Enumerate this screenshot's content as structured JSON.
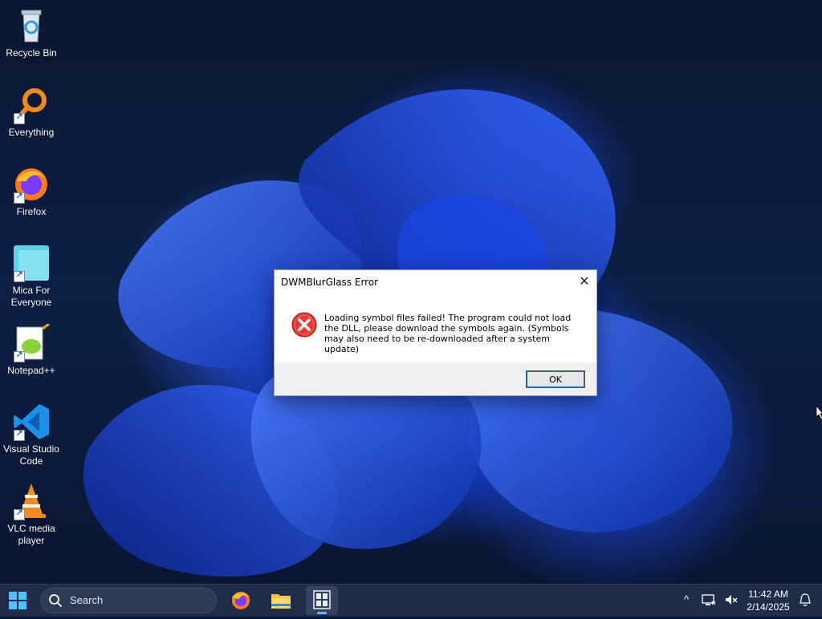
{
  "desktop": {
    "icons": [
      {
        "label": "Recycle Bin",
        "icon": "recycle-bin-icon"
      },
      {
        "label": "Everything",
        "icon": "everything-search-icon"
      },
      {
        "label": "Firefox",
        "icon": "firefox-icon"
      },
      {
        "label": "Mica For Everyone",
        "icon": "mica-icon"
      },
      {
        "label": "Notepad++",
        "icon": "notepad-plus-plus-icon"
      },
      {
        "label": "Visual Studio Code",
        "icon": "vscode-icon"
      },
      {
        "label": "VLC media player",
        "icon": "vlc-icon"
      }
    ]
  },
  "dialog": {
    "title": "DWMBlurGlass Error",
    "close_glyph": "✕",
    "message": "Loading symbol files failed! The program could not load the DLL, please download the symbols again. (Symbols may also need to be re-downloaded after a system update)",
    "ok_label": "OK",
    "icon": "error-icon"
  },
  "taskbar": {
    "search_label": "Search",
    "apps": [
      "firefox-icon",
      "file-explorer-icon",
      "dwmblurglass-icon"
    ],
    "tray": {
      "chevron": "^",
      "clock_time": "11:42 AM",
      "clock_date": "2/14/2025"
    }
  },
  "colors": {
    "taskbar_bg": "#1f2d48",
    "accent": "#0078d4",
    "error_red": "#d32f2f"
  }
}
